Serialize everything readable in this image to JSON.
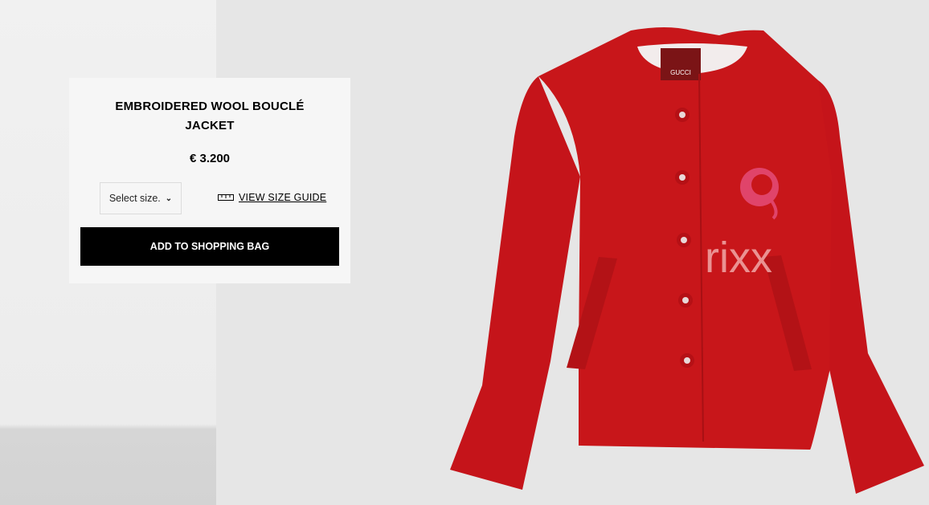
{
  "product": {
    "title": "EMBROIDERED WOOL BOUCLÉ JACKET",
    "price": "€ 3.200",
    "size_select_value": "Select size.",
    "size_guide_label": "VIEW SIZE GUIDE",
    "add_to_bag_label": "ADD TO SHOPPING BAG"
  },
  "image": {
    "brand_label": "GUCCI",
    "watermark": "rixx"
  },
  "colors": {
    "jacket": "#cc1a1a",
    "button": "#000000",
    "card": "#f6f6f6"
  }
}
